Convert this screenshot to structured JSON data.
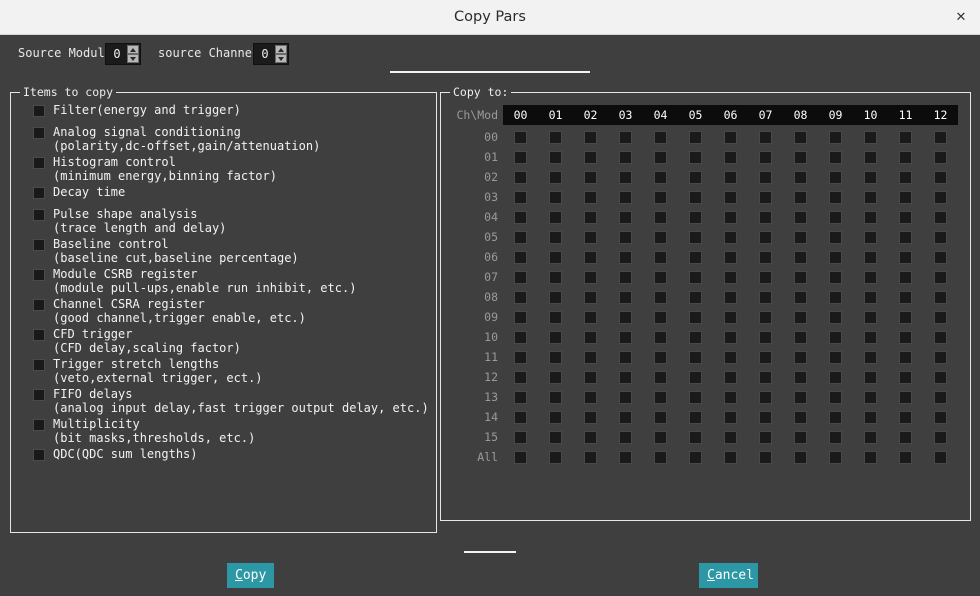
{
  "window": {
    "title": "Copy Pars",
    "close_icon": "close-icon",
    "close_glyph": "✕"
  },
  "source": {
    "module_label": "Source Module:",
    "module_value": "0",
    "channel_label": "source Channel:",
    "channel_value": "0",
    "spinner_up_icon": "chevron-up-icon",
    "spinner_down_icon": "chevron-down-icon"
  },
  "items_group": {
    "legend": "Items to copy",
    "items": [
      {
        "line1": "Filter(energy and trigger)",
        "line2": "",
        "checked": false
      },
      {
        "line1": "Analog signal conditioning",
        "line2": "(polarity,dc-offset,gain/attenuation)",
        "checked": false
      },
      {
        "line1": "Histogram control",
        "line2": "(minimum energy,binning factor)",
        "checked": false
      },
      {
        "line1": "Decay time",
        "line2": "",
        "checked": false
      },
      {
        "line1": "Pulse shape analysis",
        "line2": "(trace length and delay)",
        "checked": false
      },
      {
        "line1": "Baseline control",
        "line2": "(baseline cut,baseline percentage)",
        "checked": false
      },
      {
        "line1": "Module CSRB register",
        "line2": "(module pull-ups,enable run inhibit, etc.)",
        "checked": false
      },
      {
        "line1": "Channel CSRA register",
        "line2": "(good channel,trigger enable, etc.)",
        "checked": false
      },
      {
        "line1": "CFD trigger",
        "line2": "(CFD delay,scaling factor)",
        "checked": false
      },
      {
        "line1": "Trigger stretch lengths",
        "line2": "(veto,external trigger, ect.)",
        "checked": false
      },
      {
        "line1": "FIFO delays",
        "line2": "(analog input delay,fast trigger output delay, etc.)",
        "checked": false
      },
      {
        "line1": "Multiplicity",
        "line2": "(bit masks,thresholds, etc.)",
        "checked": false
      },
      {
        "line1": "QDC(QDC sum lengths)",
        "line2": "",
        "checked": false
      }
    ]
  },
  "copyto_group": {
    "legend": "Copy to:",
    "corner_label": "Ch\\Mod",
    "columns": [
      "00",
      "01",
      "02",
      "03",
      "04",
      "05",
      "06",
      "07",
      "08",
      "09",
      "10",
      "11",
      "12"
    ],
    "rows": [
      "00",
      "01",
      "02",
      "03",
      "04",
      "05",
      "06",
      "07",
      "08",
      "09",
      "10",
      "11",
      "12",
      "13",
      "14",
      "15",
      "All"
    ],
    "all_unchecked": true
  },
  "buttons": {
    "copy": {
      "mnemonic": "C",
      "rest": "opy"
    },
    "cancel": {
      "mnemonic": "C",
      "rest": "ancel"
    }
  },
  "colors": {
    "accent": "#2d98a5",
    "dialog_bg": "#3f3f3f",
    "titlebar_bg": "#f2f2f2",
    "grid_header_bg": "#0c0c0c",
    "checkbox_bg": "#1a1a1a",
    "text": "#f2f2f2",
    "muted_text": "#9a9a9a"
  }
}
